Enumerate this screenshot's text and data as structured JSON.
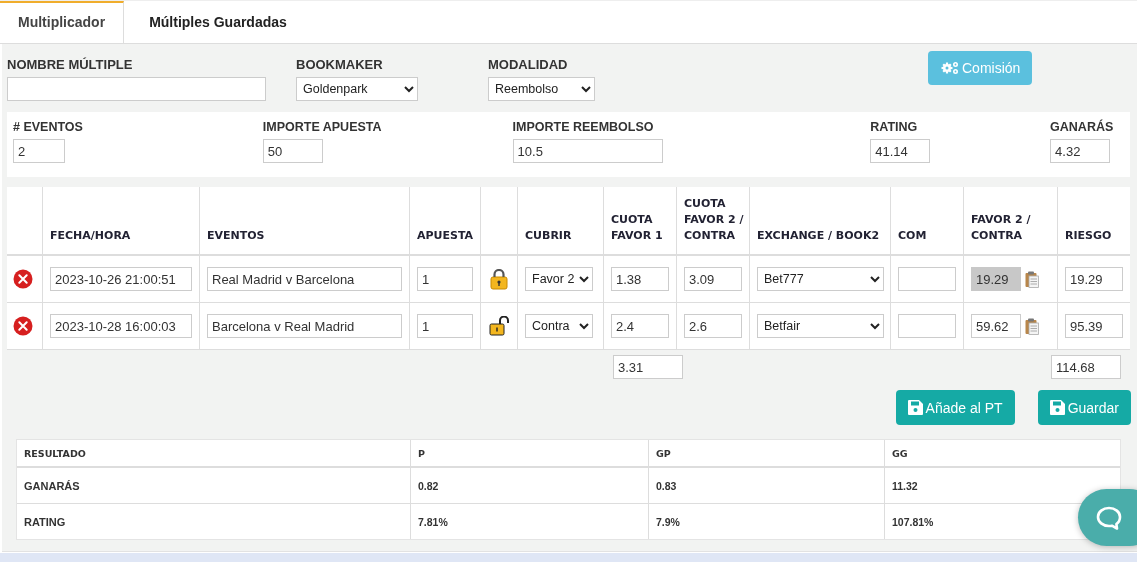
{
  "tabs": [
    {
      "label": "Multiplicador",
      "selected": true
    },
    {
      "label": "Múltiples Guardadas",
      "selected": false
    }
  ],
  "setup": {
    "name_label": "NOMBRE MÚLTIPLE",
    "bookmaker_label": "BOOKMAKER",
    "bookmaker": "Goldenpark",
    "mode_label": "MODALIDAD",
    "mode": "Reembolso",
    "commission_button": "Comisión"
  },
  "summary": [
    {
      "label": "# EVENTOS",
      "value": "2"
    },
    {
      "label": "IMPORTE APUESTA",
      "value": "50"
    },
    {
      "label": "IMPORTE REEMBOLSO",
      "value": "10.5"
    },
    {
      "label": "RATING",
      "value": "41.14"
    },
    {
      "label": "GANARÁS",
      "value": "4.32"
    }
  ],
  "table": {
    "columns": [
      {},
      {
        "label": "FECHA/HORA"
      },
      {
        "label": "EVENTOS"
      },
      {
        "label": "APUESTA"
      },
      {},
      {
        "label": "CUBRIR"
      },
      {
        "label": "CUOTA FAVOR 1"
      },
      {
        "label": "CUOTA FAVOR 2 / CONTRA"
      },
      {
        "label": "EXCHANGE / BOOK2"
      },
      {
        "label": "COM"
      },
      {
        "label": "FAVOR 2 / CONTRA"
      },
      {
        "label": "RIESGO"
      }
    ],
    "rows": [
      {
        "date": "2023-10-26 21:00:51",
        "event": "Real Madrid v Barcelona",
        "stake": "1",
        "locked": true,
        "cover": "Favor 2",
        "odds_favor1": "1.38",
        "odds_favor2": "3.09",
        "exchange": "Bet777",
        "lay": "19.29",
        "lay_disabled": true,
        "risk": "19.29"
      },
      {
        "date": "2023-10-28 16:00:03",
        "event": "Barcelona v Real Madrid",
        "stake": "1",
        "locked": false,
        "cover": "Contra",
        "odds_favor1": "2.4",
        "odds_favor2": "2.6",
        "exchange": "Betfair",
        "lay": "59.62",
        "lay_disabled": false,
        "risk": "95.39"
      }
    ],
    "totals": {
      "odds_favor1": "3.31",
      "risk": "114.68"
    }
  },
  "actions": [
    "Añade al PT",
    "Guardar"
  ],
  "results": {
    "columns": [
      "RESULTADO",
      "P",
      "GP",
      "GG"
    ],
    "rows": [
      {
        "label": "GANARÁS",
        "values": [
          "0.82",
          "0.83",
          "11.32"
        ]
      },
      {
        "label": "RATING",
        "values": [
          "7.81%",
          "7.9%",
          "107.81%"
        ]
      }
    ]
  }
}
